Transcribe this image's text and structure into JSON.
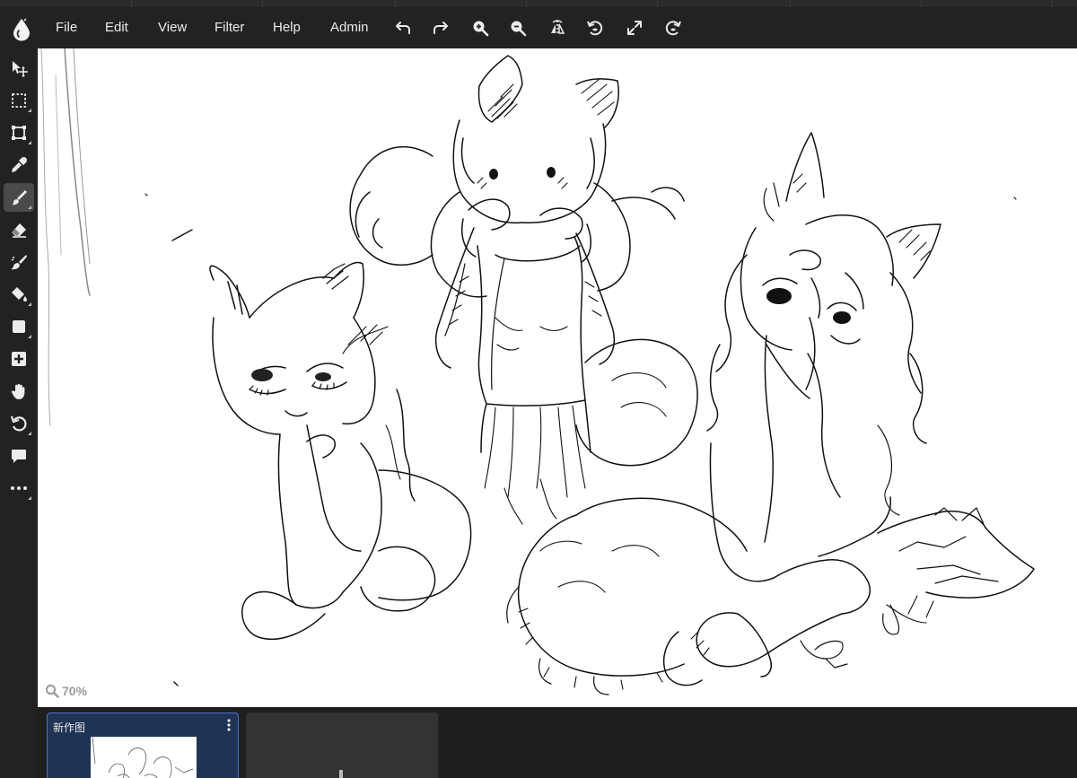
{
  "menubar": {
    "logo_icon": "droplet-logo-icon",
    "items": [
      {
        "label": "File"
      },
      {
        "label": "Edit"
      },
      {
        "label": "View"
      },
      {
        "label": "Filter"
      },
      {
        "label": "Help"
      },
      {
        "label": "Admin"
      }
    ],
    "actions": [
      "undo-icon",
      "redo-icon",
      "zoom-in-icon",
      "zoom-out-icon",
      "flip-horizontal-icon",
      "rotate-left-icon",
      "fullscreen-icon",
      "rotate-right-icon"
    ]
  },
  "toolbar": {
    "tools": [
      "move-icon",
      "select-rect-icon",
      "transform-icon",
      "eyedropper-icon",
      "brush-icon",
      "eraser-icon",
      "smudge-icon",
      "fill-bucket-icon",
      "shape-icon",
      "add-icon",
      "hand-icon",
      "rotate-canvas-icon",
      "comment-icon",
      "more-icon"
    ],
    "active_tool": "brush-icon"
  },
  "canvas": {
    "zoom": "70%"
  },
  "documents": {
    "items": [
      {
        "name": "新作图"
      }
    ]
  },
  "colors": {
    "background": "#1e1e1e",
    "panel": "#222222",
    "active_tool": "#4a4a4a",
    "selected_card": "#1f3355",
    "selected_border": "#4a74c4"
  }
}
